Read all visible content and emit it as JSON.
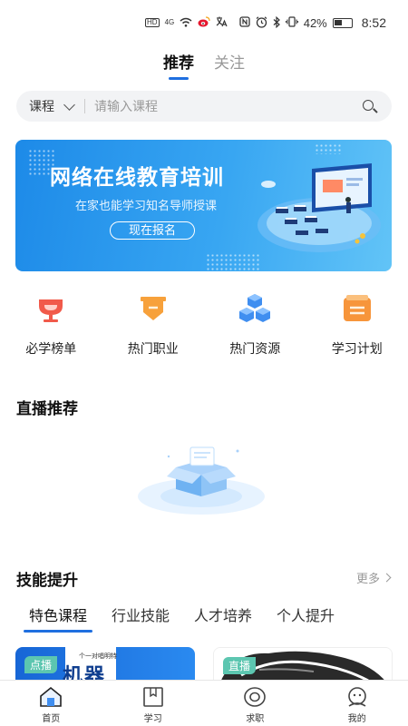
{
  "status": {
    "left_icons": [
      "HD",
      "4G",
      "wifi-icon",
      "weibo-icon",
      "translate-icon"
    ],
    "battery": "42%",
    "time": "8:52"
  },
  "top_tabs": [
    {
      "label": "推荐",
      "active": true
    },
    {
      "label": "关注",
      "active": false
    }
  ],
  "search": {
    "category": "课程",
    "placeholder": "请输入课程"
  },
  "banner": {
    "title": "网络在线教育培训",
    "subtitle": "在家也能学习知名导师授课",
    "button": "现在报名"
  },
  "quick_links": [
    {
      "label": "必学榜单",
      "icon": "trophy-icon",
      "color": "#f15a4a"
    },
    {
      "label": "热门职业",
      "icon": "badge-icon",
      "color": "#f7a13b"
    },
    {
      "label": "热门资源",
      "icon": "cubes-icon",
      "color": "#3f8ef0"
    },
    {
      "label": "学习计划",
      "icon": "plan-icon",
      "color": "#f7953b"
    }
  ],
  "live": {
    "title": "直播推荐"
  },
  "skills": {
    "title": "技能提升",
    "more": "更多",
    "tabs": [
      {
        "label": "特色课程",
        "active": true
      },
      {
        "label": "行业技能",
        "active": false
      },
      {
        "label": "人才培养",
        "active": false
      },
      {
        "label": "个人提升",
        "active": false
      }
    ],
    "cards": [
      {
        "badge": "点播",
        "art_big": "机器",
        "art_small": "个一对唱明特"
      },
      {
        "badge": "直播"
      }
    ]
  },
  "nav": [
    {
      "label": "首页",
      "icon": "home-icon",
      "active": true
    },
    {
      "label": "学习",
      "icon": "book-icon",
      "active": false
    },
    {
      "label": "求职",
      "icon": "target-icon",
      "active": false
    },
    {
      "label": "我的",
      "icon": "profile-icon",
      "active": false
    }
  ]
}
